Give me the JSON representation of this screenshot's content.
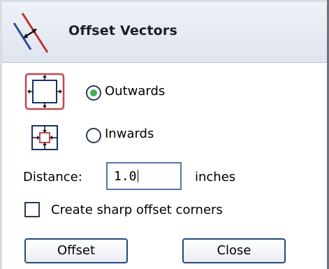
{
  "dialog": {
    "title": "Offset Vectors",
    "logo_icon": "offset-vectors-icon"
  },
  "direction": {
    "outwards_label": "Outwards",
    "outwards_icon": "offset-outwards-icon",
    "inwards_label": "Inwards",
    "inwards_icon": "offset-inwards-icon",
    "selected": "Outwards"
  },
  "distance": {
    "label": "Distance:",
    "value": "1.0",
    "unit": "inches"
  },
  "options": {
    "sharp_corners_label": "Create sharp offset corners",
    "sharp_corners_checked": false
  },
  "buttons": {
    "offset_label": "Offset",
    "close_label": "Close"
  },
  "colors": {
    "accent_green": "#3db24b",
    "outline_red": "#c04850",
    "button_border": "#24497e"
  }
}
